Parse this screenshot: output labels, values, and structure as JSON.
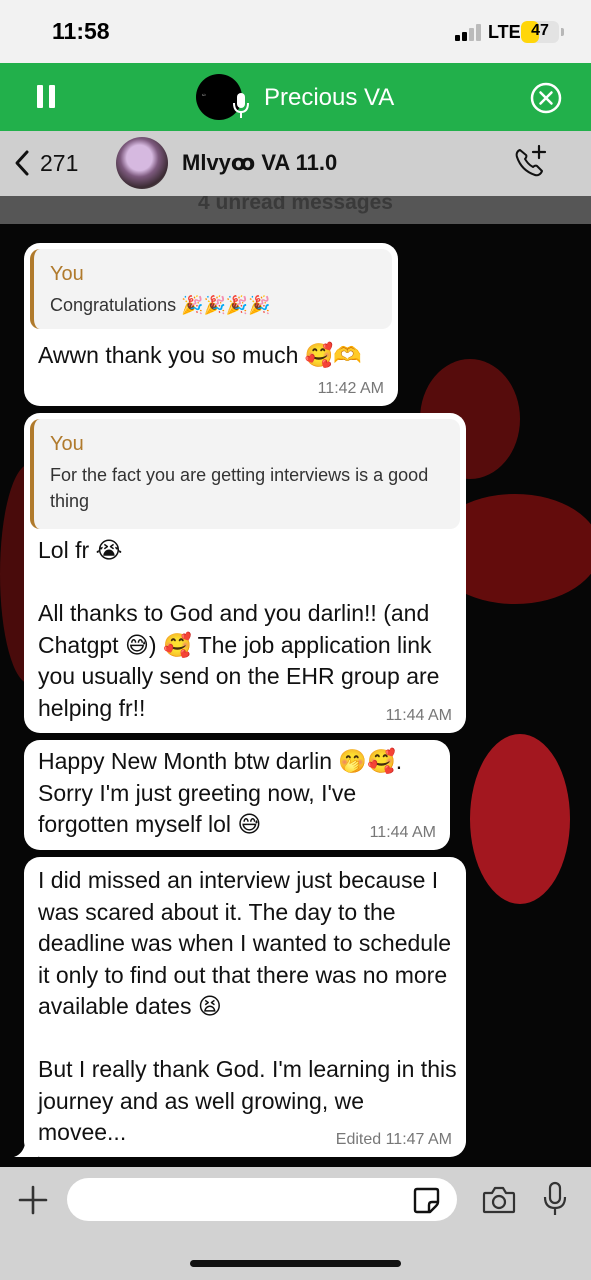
{
  "status_bar": {
    "time": "11:58",
    "network": "LTE",
    "battery": "47",
    "battery_level": 0.47
  },
  "voice_chat": {
    "title": "Precious VA",
    "progress": 0.655
  },
  "chat_header": {
    "back_count": "271",
    "name": "Mlvyꝏ VA 11.0"
  },
  "unread_label": "4 unread messages",
  "messages": [
    {
      "quote_author": "You",
      "quote_text": "Congratulations 🎉🎉🎉🎉",
      "text": "Awwn thank you so much 🥰🫶",
      "time": "11:42 AM"
    },
    {
      "quote_author": "You",
      "quote_text": "For the fact you are getting interviews is a good thing",
      "text": "Lol fr 😭\n\nAll thanks to God and you darlin!! (and Chatgpt 😅) 🥰 The job application link you usually send on the EHR group are helping fr!!",
      "time": "11:44 AM"
    },
    {
      "text": "Happy New Month btw darlin 🤭🥰.\nSorry I'm just greeting now, I've forgotten myself lol 😅",
      "time": "11:44 AM"
    },
    {
      "text": "I did missed an interview just because I was scared about it. The day to the deadline was when I wanted to schedule it only to find out that there was no more available dates 😫\n\nBut I really thank God. I'm learning in this journey and as well growing, we movee...",
      "time": "Edited 11:47 AM"
    }
  ],
  "input": {
    "placeholder": ""
  },
  "colors": {
    "voice_bar": "#22b04b",
    "quote_accent": "#b07a2c",
    "battery": "#ffd60a"
  }
}
